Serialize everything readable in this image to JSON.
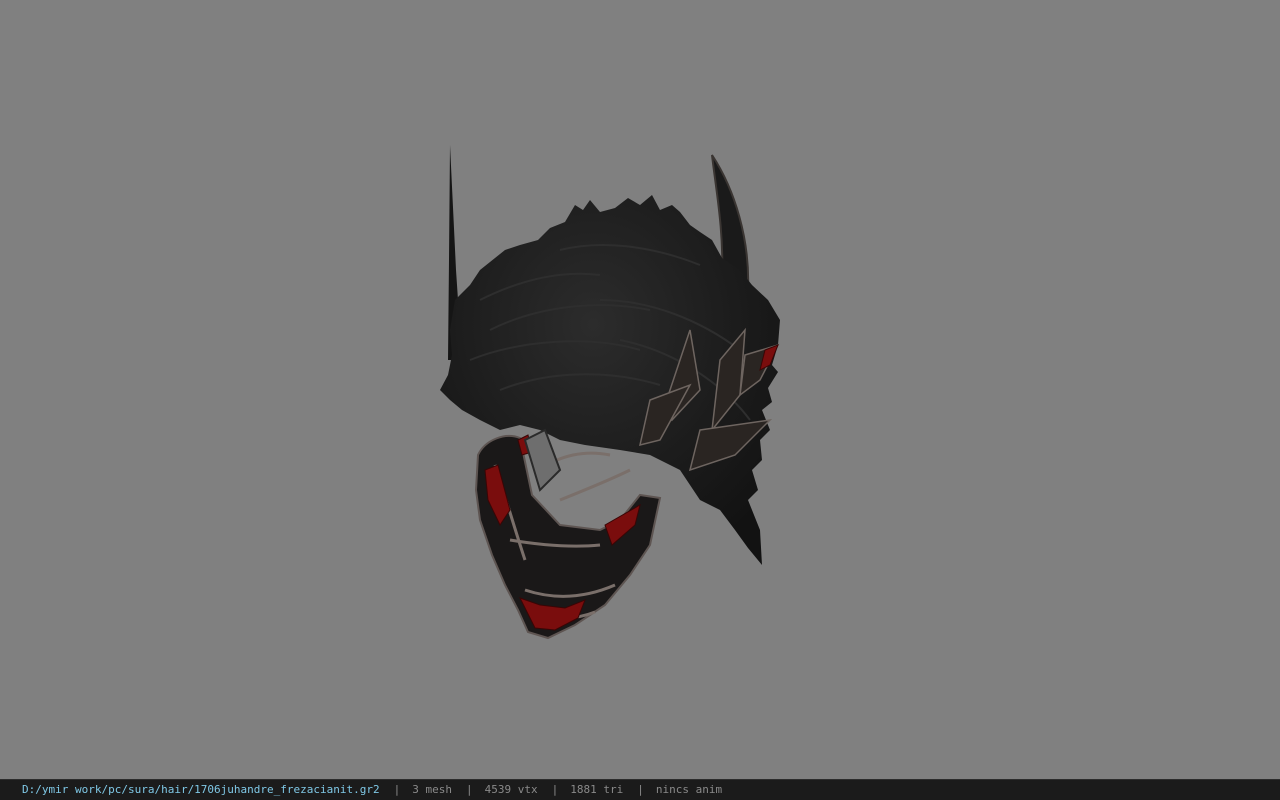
{
  "viewer": {
    "background_color": "#808080",
    "model_icon": "hair-mesh-3d-model"
  },
  "status_bar": {
    "file_path": "D:/ymir work/pc/sura/hair/1706juhandre_frezacianit.gr2",
    "separator": "|",
    "mesh_count": "3 mesh",
    "vertex_count": "4539 vtx",
    "triangle_count": "1881 tri",
    "animation": "nincs anim",
    "path_color": "#7fc8e6"
  }
}
